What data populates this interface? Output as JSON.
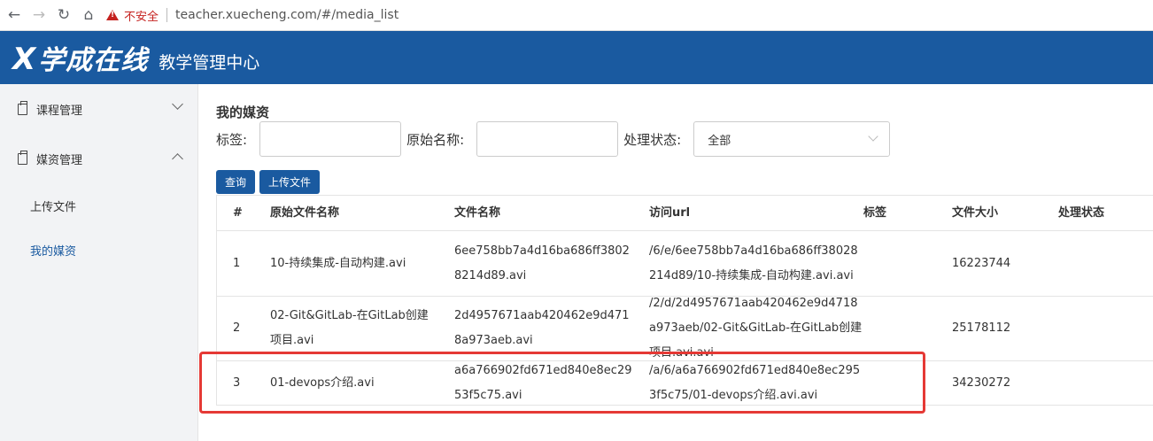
{
  "browser": {
    "security_label": "不安全",
    "url": "teacher.xuecheng.com/#/media_list"
  },
  "header": {
    "logo_text": "学成在线",
    "logo_x": "X",
    "title": "教学管理中心"
  },
  "sidebar": {
    "groups": [
      {
        "label": "课程管理"
      },
      {
        "label": "媒资管理"
      }
    ],
    "subitems": [
      {
        "label": "上传文件"
      },
      {
        "label": "我的媒资"
      }
    ]
  },
  "main": {
    "title": "我的媒资",
    "filter": {
      "tag_label": "标签:",
      "original_name_label": "原始名称:",
      "status_label": "处理状态:",
      "status_value": "全部"
    },
    "buttons": {
      "query": "查询",
      "upload": "上传文件"
    },
    "table": {
      "headers": [
        "#",
        "原始文件名称",
        "文件名称",
        "访问url",
        "标签",
        "文件大小",
        "处理状态"
      ],
      "rows": [
        {
          "index": "1",
          "original_name": "10-持续集成-自动构建.avi",
          "file_name": "6ee758bb7a4d16ba686ff38028214d89.avi",
          "url": "/6/e/6ee758bb7a4d16ba686ff38028214d89/10-持续集成-自动构建.avi.avi",
          "tag": "",
          "size": "16223744",
          "status": ""
        },
        {
          "index": "2",
          "original_name": "02-Git&GitLab-在GitLab创建项目.avi",
          "file_name": "2d4957671aab420462e9d4718a973aeb.avi",
          "url": "/2/d/2d4957671aab420462e9d4718a973aeb/02-Git&GitLab-在GitLab创建项目.avi.avi",
          "tag": "",
          "size": "25178112",
          "status": ""
        },
        {
          "index": "3",
          "original_name": "01-devops介绍.avi",
          "file_name": "a6a766902fd671ed840e8ec2953f5c75.avi",
          "url": "/a/6/a6a766902fd671ed840e8ec2953f5c75/01-devops介绍.avi.avi",
          "tag": "",
          "size": "34230272",
          "status": ""
        }
      ]
    }
  }
}
